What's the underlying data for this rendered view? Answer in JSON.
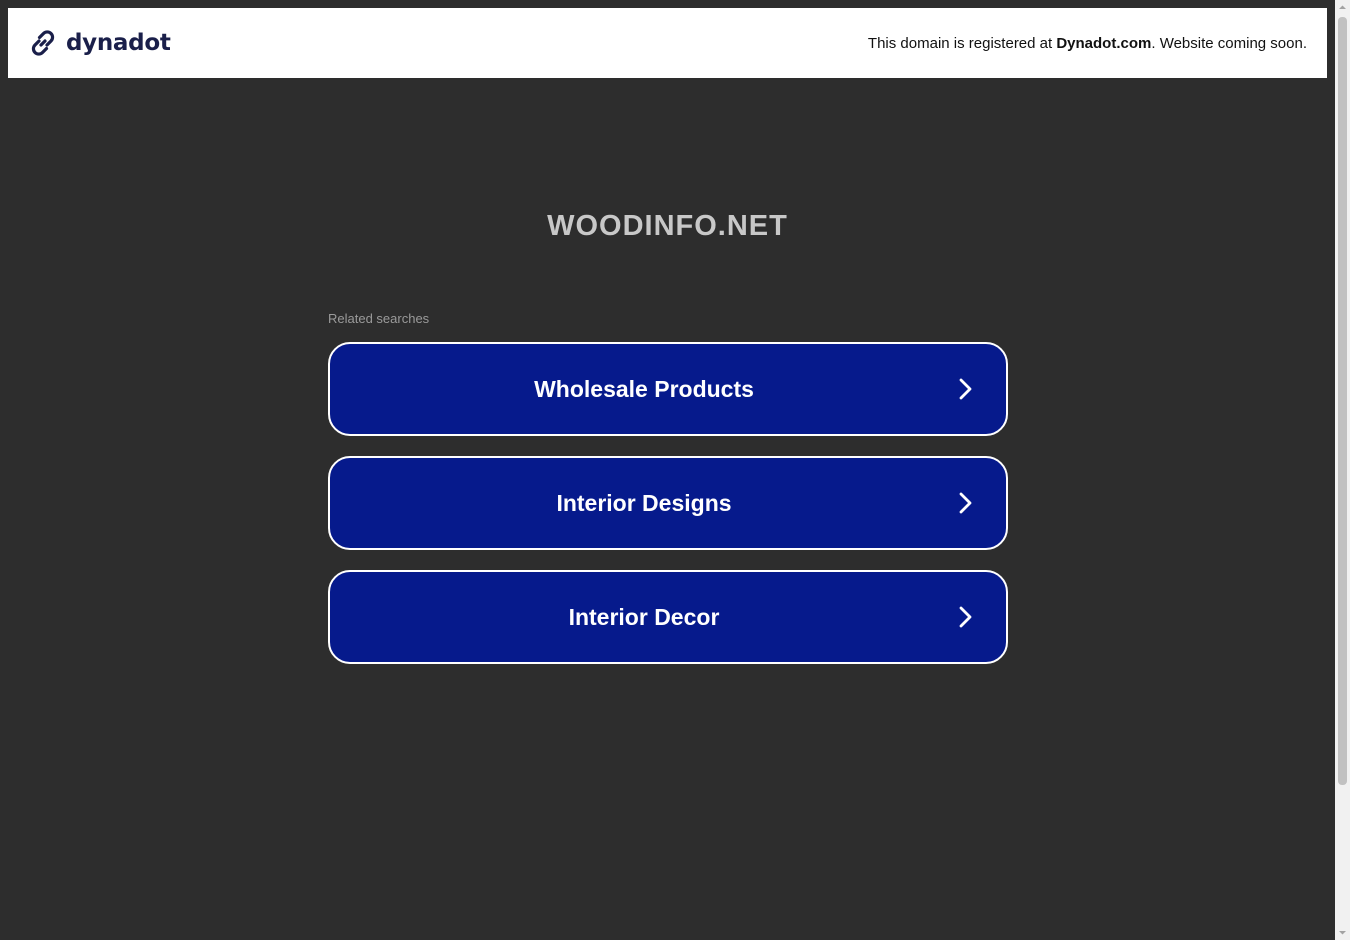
{
  "header": {
    "brand_name": "dynadot",
    "registered_prefix": "This domain is registered at ",
    "registered_brand": "Dynadot.com",
    "registered_suffix": ". Website coming soon."
  },
  "main": {
    "domain": "WOODINFO.NET",
    "related_label": "Related searches",
    "links": [
      {
        "label": "Wholesale Products"
      },
      {
        "label": "Interior Designs"
      },
      {
        "label": "Interior Decor"
      }
    ]
  },
  "colors": {
    "page_bg": "#2d2d2d",
    "button_bg": "#061a8c",
    "brand_dark": "#1a1f4a"
  },
  "icons": {
    "logo": "chain-link-icon",
    "link_arrow": "chevron-right-icon"
  }
}
